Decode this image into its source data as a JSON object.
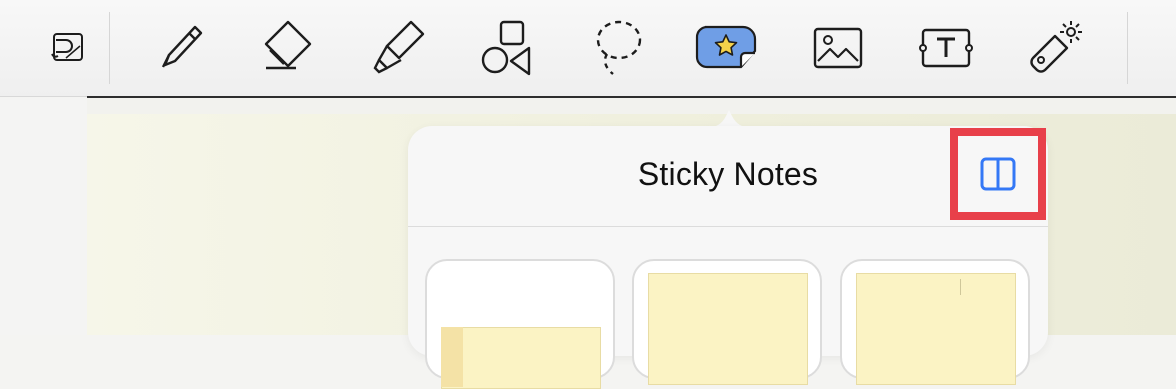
{
  "toolbar": {
    "tools": [
      {
        "name": "read-only-mode-icon"
      },
      {
        "name": "pen-icon"
      },
      {
        "name": "eraser-icon"
      },
      {
        "name": "highlighter-icon"
      },
      {
        "name": "shapes-icon"
      },
      {
        "name": "lasso-icon"
      },
      {
        "name": "sticky-note-icon",
        "selected": true
      },
      {
        "name": "image-icon"
      },
      {
        "name": "text-icon"
      },
      {
        "name": "laser-pointer-icon"
      }
    ],
    "colors": {
      "selected_fill": "#6f9ee6",
      "star": "#f5d24a",
      "stroke": "#1d1d1d"
    }
  },
  "popover": {
    "title": "Sticky Notes",
    "layout_button_icon": "split-view-icon",
    "highlight_color": "#e8404a",
    "accent_color": "#3478f6",
    "note_color": "#fbf3c4"
  }
}
